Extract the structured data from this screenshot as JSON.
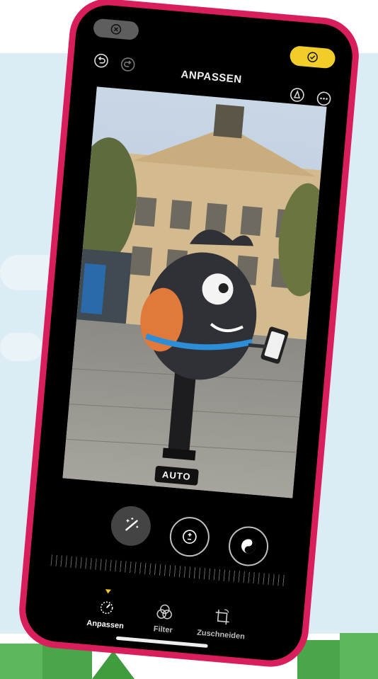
{
  "header": {
    "title": "ANPASSEN",
    "cancel_icon": "close-circle-icon",
    "done_icon": "checkmark-circle-icon",
    "undo_icon": "undo-icon",
    "redo_icon": "redo-icon",
    "markup_icon": "markup-pen-icon",
    "more_icon": "more-icon"
  },
  "photo": {
    "mode_label": "AUTO"
  },
  "tools": [
    {
      "name": "auto-enhance",
      "icon": "magic-wand-icon",
      "active": true
    },
    {
      "name": "exposure",
      "icon": "plus-minus-icon"
    },
    {
      "name": "brilliance",
      "icon": "yin-yang-icon"
    }
  ],
  "tabs": [
    {
      "label": "Anpassen",
      "icon": "adjust-dial-icon",
      "active": true
    },
    {
      "label": "Filter",
      "icon": "filter-circles-icon"
    },
    {
      "label": "Zuschneiden",
      "icon": "crop-rotate-icon"
    }
  ],
  "colors": {
    "accent": "#f2cd2a",
    "frame": "#d81e5b",
    "screen": "#000000"
  }
}
